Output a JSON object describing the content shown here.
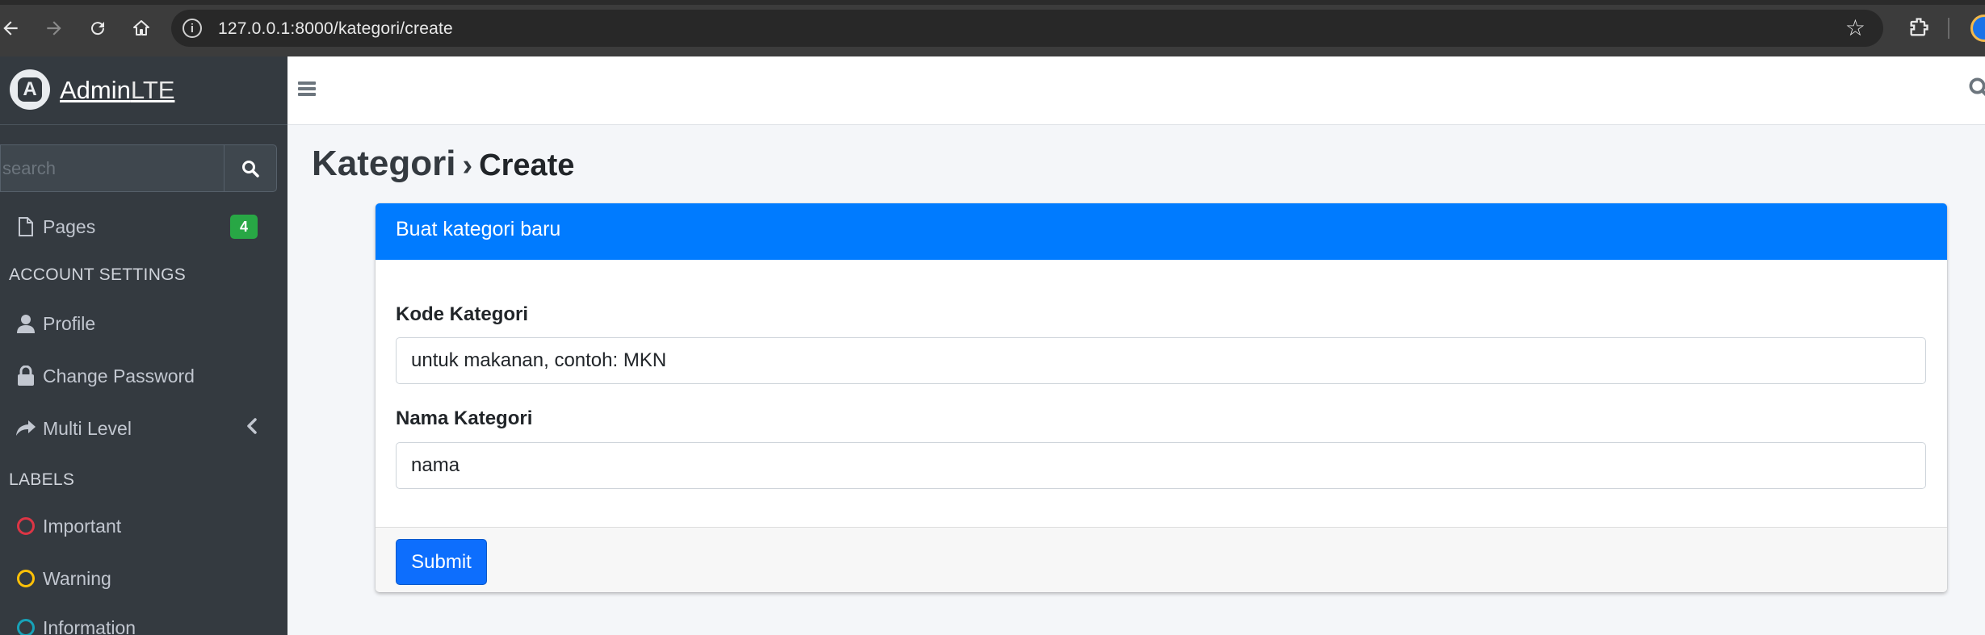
{
  "browser": {
    "url": "127.0.0.1:8000/kategori/create",
    "back_icon": "arrow-left-icon",
    "forward_icon": "arrow-right-icon",
    "reload_icon": "reload-icon",
    "home_icon": "home-icon"
  },
  "sidebar": {
    "brand": {
      "name_bold": "Admin",
      "name_light": "LTE"
    },
    "search": {
      "placeholder": "search"
    },
    "items": [
      {
        "label": "Pages",
        "icon": "file-icon",
        "badge": "4",
        "badge_color": "#28a745"
      },
      {
        "label": "Profile",
        "icon": "user-icon"
      },
      {
        "label": "Change Password",
        "icon": "lock-icon"
      },
      {
        "label": "Multi Level",
        "icon": "share-icon"
      }
    ],
    "sections": {
      "account": "ACCOUNT SETTINGS",
      "labels": "LABELS"
    },
    "labels": [
      {
        "label": "Important",
        "color": "#dc3545"
      },
      {
        "label": "Warning",
        "color": "#ffc107"
      },
      {
        "label": "Information",
        "color": "#17a2b8"
      }
    ]
  },
  "content": {
    "title": "Kategori",
    "separator": "›",
    "subtitle": "Create",
    "card": {
      "header": "Buat kategori baru",
      "header_color": "#007bff",
      "fields": [
        {
          "label": "Kode Kategori",
          "placeholder": "untuk makanan, contoh: MKN"
        },
        {
          "label": "Nama Kategori",
          "placeholder": "nama"
        }
      ],
      "submit_label": "Submit"
    }
  }
}
